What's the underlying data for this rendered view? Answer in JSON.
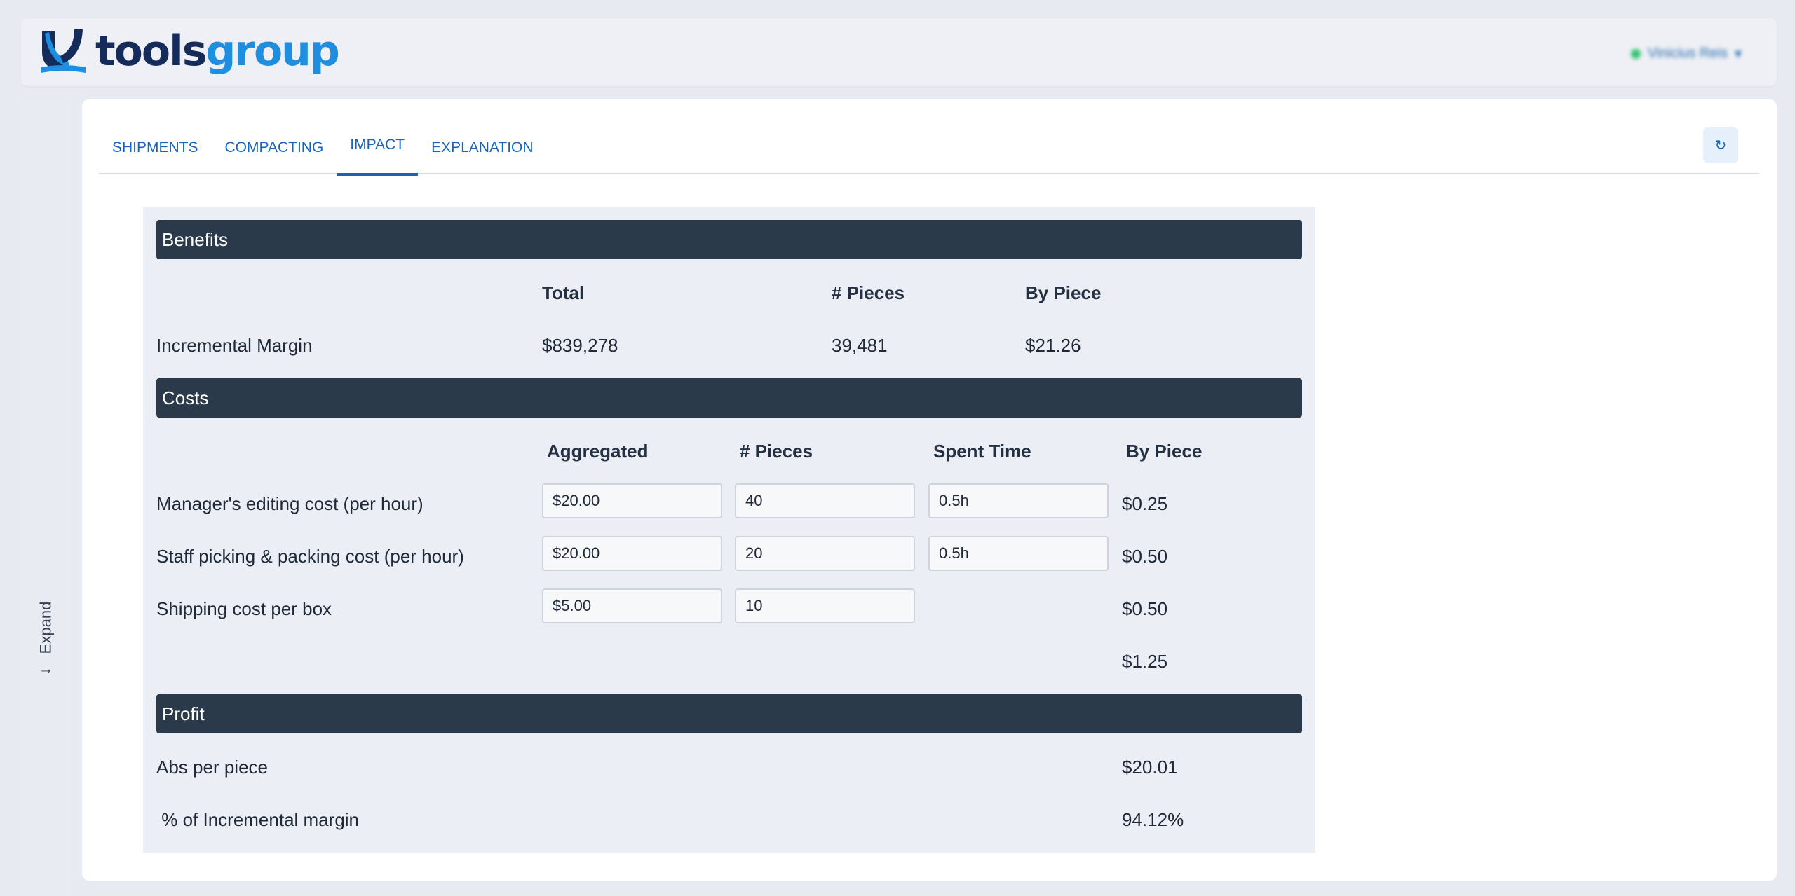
{
  "header": {
    "logo_tools": "tools",
    "logo_group": "group",
    "user_name": "Vinicius Reis",
    "accent_color": "#1565c0"
  },
  "sidebar": {
    "expand_label": "Expand",
    "expand_icon": "arrow-right-icon"
  },
  "tabs": [
    {
      "label": "SHIPMENTS",
      "active": false
    },
    {
      "label": "COMPACTING",
      "active": false
    },
    {
      "label": "IMPACT",
      "active": true
    },
    {
      "label": "EXPLANATION",
      "active": false
    }
  ],
  "toolbar": {
    "refresh_icon": "refresh-icon"
  },
  "benefits": {
    "title": "Benefits",
    "headers": {
      "total": "Total",
      "pieces": "# Pieces",
      "by_piece": "By Piece"
    },
    "row": {
      "label": "Incremental Margin",
      "total": "$839,278",
      "pieces": "39,481",
      "by_piece": "$21.26"
    }
  },
  "costs": {
    "title": "Costs",
    "headers": {
      "aggregated": "Aggregated",
      "pieces": "# Pieces",
      "spent_time": "Spent Time",
      "by_piece": "By Piece"
    },
    "rows": [
      {
        "label": "Manager's editing cost (per hour)",
        "aggregated": "$20.00",
        "pieces": "40",
        "spent_time": "0.5h",
        "by_piece": "$0.25"
      },
      {
        "label": "Staff picking & packing cost (per hour)",
        "aggregated": "$20.00",
        "pieces": "20",
        "spent_time": "0.5h",
        "by_piece": "$0.50"
      },
      {
        "label": "Shipping cost per box",
        "aggregated": "$5.00",
        "pieces": "10",
        "by_piece": "$0.50"
      }
    ],
    "total_by_piece": "$1.25"
  },
  "profit": {
    "title": "Profit",
    "rows": [
      {
        "label": "Abs per piece",
        "value": "$20.01"
      },
      {
        "label": " % of Incremental margin",
        "value": "94.12%"
      }
    ]
  }
}
